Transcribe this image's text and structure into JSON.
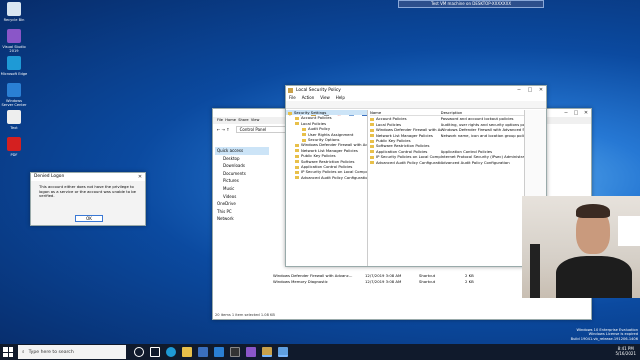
{
  "desktop": {
    "icons": [
      {
        "label": "Recycle Bin",
        "color": "#d9e6f2"
      },
      {
        "label": "Visual Studio 2019",
        "color": "#8a56c8"
      },
      {
        "label": "Microsoft Edge",
        "color": "#1e9ad6"
      },
      {
        "label": "Windows Server Center",
        "color": "#2a7fd4"
      },
      {
        "label": "Text",
        "color": "#eeeeee"
      },
      {
        "label": "PDF",
        "color": "#d42020"
      }
    ]
  },
  "vm_bar": {
    "title": "Test VM machine on DESKTOP-XXXXXXX"
  },
  "explorer": {
    "address": "Control Panel",
    "nav": [
      "Quick access",
      "Desktop",
      "Downloads",
      "Documents",
      "Pictures",
      "Music",
      "Videos",
      "OneDrive",
      "This PC",
      "Network"
    ],
    "rows": [
      {
        "name": "Windows Defender Firewall with Advanc...",
        "date": "12/7/2019 3:08 AM",
        "type": "Shortcut",
        "size": "2 KB"
      },
      {
        "name": "Windows Memory Diagnostic",
        "date": "12/7/2019 3:08 AM",
        "type": "Shortcut",
        "size": "2 KB"
      }
    ],
    "status": "20 items    1 item selected  1.08 KB"
  },
  "secpol": {
    "title": "Local Security Policy",
    "menu": [
      "File",
      "Action",
      "View",
      "Help"
    ],
    "tree": [
      {
        "label": "Security Settings",
        "lvl": 0
      },
      {
        "label": "Account Policies",
        "lvl": 1
      },
      {
        "label": "Local Policies",
        "lvl": 1
      },
      {
        "label": "Audit Policy",
        "lvl": 2
      },
      {
        "label": "User Rights Assignment",
        "lvl": 2
      },
      {
        "label": "Security Options",
        "lvl": 2
      },
      {
        "label": "Windows Defender Firewall with Adv...",
        "lvl": 1
      },
      {
        "label": "Network List Manager Policies",
        "lvl": 1
      },
      {
        "label": "Public Key Policies",
        "lvl": 1
      },
      {
        "label": "Software Restriction Policies",
        "lvl": 1
      },
      {
        "label": "Application Control Policies",
        "lvl": 1
      },
      {
        "label": "IP Security Policies on Local Compu...",
        "lvl": 1
      },
      {
        "label": "Advanced Audit Policy Configuration",
        "lvl": 1
      }
    ],
    "columns": [
      "Name",
      "Description"
    ],
    "items": [
      {
        "name": "Account Policies",
        "desc": "Password and account lockout policies"
      },
      {
        "name": "Local Policies",
        "desc": "Auditing, user rights and security options polic..."
      },
      {
        "name": "Windows Defender Firewall with Advanc...",
        "desc": "Windows Defender Firewall with Advanced Sec..."
      },
      {
        "name": "Network List Manager Policies",
        "desc": "Network name, icon and location group policies"
      },
      {
        "name": "Public Key Policies",
        "desc": ""
      },
      {
        "name": "Software Restriction Policies",
        "desc": ""
      },
      {
        "name": "Application Control Policies",
        "desc": "Application Control Policies"
      },
      {
        "name": "IP Security Policies on Local Computer",
        "desc": "Internet Protocol Security (IPsec) Administratio..."
      },
      {
        "name": "Advanced Audit Policy Configuration",
        "desc": "Advanced Audit Policy Configuration"
      }
    ]
  },
  "dialog": {
    "title": "Denied Logon",
    "message": "This account either does not have the privilege to logon as a service or the account was unable to be verified.",
    "ok": "OK"
  },
  "watermark": {
    "line1": "Windows 10 Enterprise Evaluation",
    "line2": "Windows License is expired",
    "line3": "Build 19041.vb_release.191206-1406"
  },
  "taskbar": {
    "search_placeholder": "Type here to search",
    "time": "8:41 PM",
    "date": "5/16/2021"
  }
}
